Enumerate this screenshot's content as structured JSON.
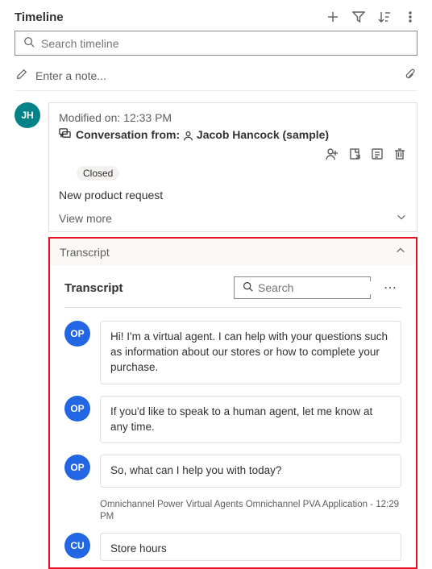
{
  "header": {
    "title": "Timeline"
  },
  "search": {
    "placeholder": "Search timeline"
  },
  "note": {
    "placeholder": "Enter a note..."
  },
  "entry": {
    "avatar_initials": "JH",
    "modified_label": "Modified on: 12:33 PM",
    "subject_prefix": "Conversation from:",
    "subject_name": "Jacob Hancock (sample)",
    "status_badge": "Closed",
    "summary": "New product request",
    "view_more": "View more"
  },
  "transcript": {
    "header_label": "Transcript",
    "title": "Transcript",
    "search_placeholder": "Search",
    "messages": [
      {
        "initials": "OP",
        "text": "Hi! I'm a virtual agent. I can help with your questions such as information about our stores or how to complete your purchase."
      },
      {
        "initials": "OP",
        "text": "If you'd like to speak to a human agent, let me know at any time."
      },
      {
        "initials": "OP",
        "text": "So, what can I help you with today?"
      }
    ],
    "meta": "Omnichannel Power Virtual Agents Omnichannel PVA Application - 12:29 PM",
    "customer": {
      "initials": "CU",
      "text": "Store hours"
    }
  }
}
